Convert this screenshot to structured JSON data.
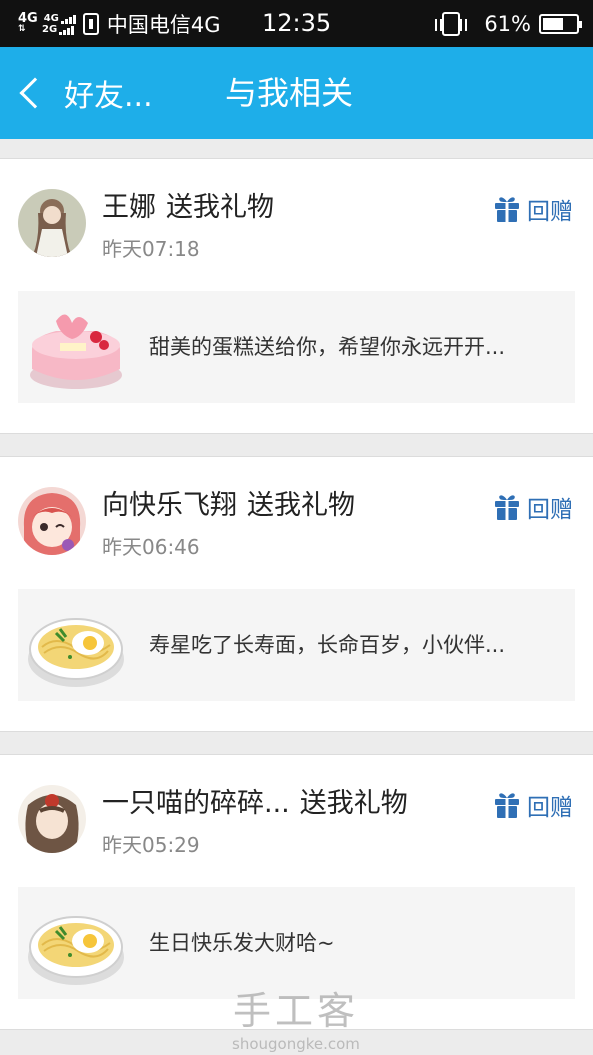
{
  "status_bar": {
    "net_top": "4G",
    "net_small_1": "4G",
    "net_small_2": "2G",
    "carrier": "中国电信4G",
    "time": "12:35",
    "battery": "61%",
    "battery_level": 0.61
  },
  "header": {
    "back_label": "好友...",
    "title": "与我相关"
  },
  "notifications": [
    {
      "name": "王娜",
      "action": "送我礼物",
      "time": "昨天07:18",
      "regift_label": "回赠",
      "gift_icon": "cake",
      "message": "甜美的蛋糕送给你，希望你永远开开..."
    },
    {
      "name": "向快乐飞翔",
      "action": "送我礼物",
      "time": "昨天06:46",
      "regift_label": "回赠",
      "gift_icon": "noodles",
      "message": "寿星吃了长寿面，长命百岁，小伙伴..."
    },
    {
      "name": "一只喵的碎碎...",
      "action": "送我礼物",
      "time": "昨天05:29",
      "regift_label": "回赠",
      "gift_icon": "noodles",
      "message": "生日快乐发大财哈~"
    }
  ],
  "watermark": {
    "cn": "手工客",
    "en": "shougongke.com"
  },
  "colors": {
    "header": "#1eaee9",
    "accent": "#2f6fb5"
  }
}
